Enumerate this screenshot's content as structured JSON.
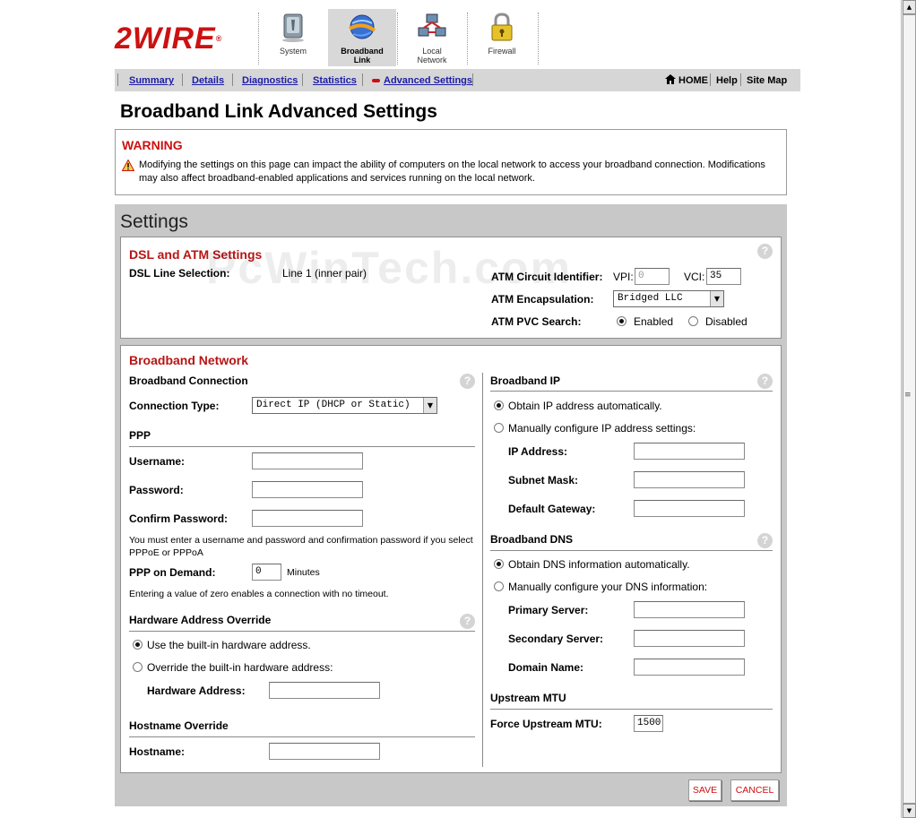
{
  "brand": {
    "logo_text": "2WIRE",
    "trademark": "®"
  },
  "tabs": [
    {
      "id": "system",
      "label_line1": "System",
      "label_line2": "",
      "icon": "system-icon"
    },
    {
      "id": "broadband",
      "label_line1": "Broadband",
      "label_line2": "Link",
      "icon": "broadband-globe-icon",
      "active": true
    },
    {
      "id": "local",
      "label_line1": "Local",
      "label_line2": "Network",
      "icon": "local-network-icon"
    },
    {
      "id": "firewall",
      "label_line1": "Firewall",
      "label_line2": "",
      "icon": "padlock-icon"
    }
  ],
  "subnav": {
    "links": [
      "Summary",
      "Details",
      "Diagnostics",
      "Statistics",
      "Advanced Settings"
    ],
    "active": "Advanced Settings",
    "right": {
      "home": "HOME",
      "help": "Help",
      "sitemap": "Site Map"
    }
  },
  "page": {
    "title": "Broadband Link Advanced Settings"
  },
  "warning": {
    "title": "WARNING",
    "text": "Modifying the settings on this page can impact the ability of computers on the local network to access your broadband connection. Modifications may also affect broadband-enabled applications and services running on the local network."
  },
  "settings": {
    "title": "Settings",
    "dsl": {
      "heading": "DSL and ATM Settings",
      "line_selection_label": "DSL Line Selection:",
      "line_selection_value": "Line 1 (inner pair)",
      "atm_circuit_label": "ATM Circuit Identifier:",
      "vpi_label": "VPI:",
      "vpi_value": "0",
      "vci_label": "VCI:",
      "vci_value": "35",
      "encapsulation_label": "ATM Encapsulation:",
      "encapsulation_value": "Bridged LLC",
      "pvc_label": "ATM PVC Search:",
      "pvc_enabled": "Enabled",
      "pvc_disabled": "Disabled"
    },
    "network": {
      "heading": "Broadband Network",
      "connection": {
        "heading": "Broadband Connection",
        "type_label": "Connection Type:",
        "type_value": "Direct IP (DHCP or Static)"
      },
      "ppp": {
        "heading": "PPP",
        "username_label": "Username:",
        "password_label": "Password:",
        "confirm_label": "Confirm Password:",
        "note": "You must enter a username and password and confirmation password if you select PPPoE or PPPoA",
        "on_demand_label": "PPP on Demand:",
        "on_demand_value": "0",
        "minutes": "Minutes",
        "timeout_note": "Entering a value of zero enables a connection with no timeout."
      },
      "hw": {
        "heading": "Hardware Address Override",
        "builtin": "Use the built-in hardware address.",
        "override": "Override the built-in hardware address:",
        "address_label": "Hardware Address:"
      },
      "hostname": {
        "heading": "Hostname Override",
        "label": "Hostname:"
      },
      "ip": {
        "heading": "Broadband IP",
        "auto": "Obtain IP address automatically.",
        "manual": "Manually configure IP address settings:",
        "ip_label": "IP Address:",
        "subnet_label": "Subnet Mask:",
        "gateway_label": "Default Gateway:"
      },
      "dns": {
        "heading": "Broadband DNS",
        "auto": "Obtain DNS information automatically.",
        "manual": "Manually configure your DNS information:",
        "primary_label": "Primary Server:",
        "secondary_label": "Secondary Server:",
        "domain_label": "Domain Name:"
      },
      "mtu": {
        "heading": "Upstream MTU",
        "label": "Force Upstream MTU:",
        "value": "1500"
      }
    },
    "buttons": {
      "save": "SAVE",
      "cancel": "CANCEL"
    }
  },
  "watermark": "PcWinTech.com",
  "colors": {
    "accent": "#cc1111",
    "section_red": "#b81414",
    "nav_link": "#1c1ca6",
    "panel_gray": "#c8c8c8"
  }
}
